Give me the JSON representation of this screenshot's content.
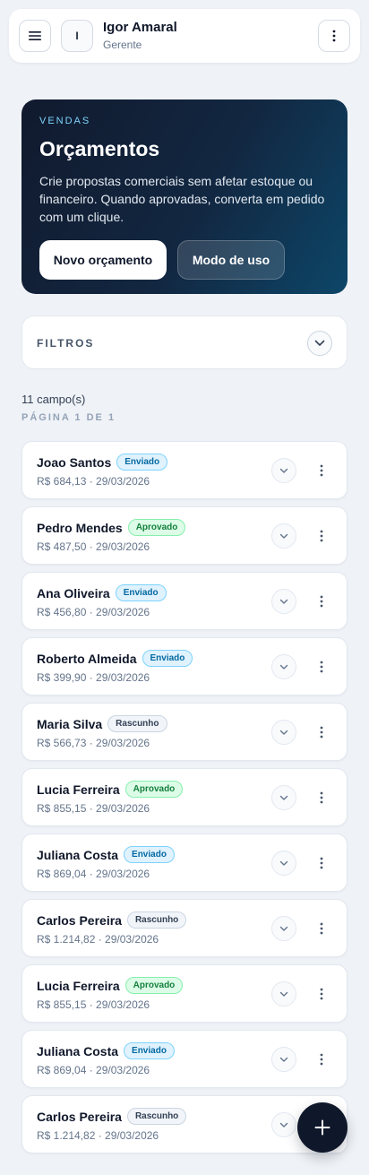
{
  "header": {
    "avatar_initial": "I",
    "user_name": "Igor Amaral",
    "user_role": "Gerente"
  },
  "hero": {
    "eyebrow": "VENDAS",
    "title": "Orçamentos",
    "description": "Crie propostas comerciais sem afetar estoque ou financeiro. Quando aprovadas, converta em pedido com um clique.",
    "primary_button": "Novo orçamento",
    "secondary_button": "Modo de uso"
  },
  "filters": {
    "label": "FILTROS"
  },
  "summary": {
    "count": "11 campo(s)",
    "page": "PÁGINA 1 DE 1"
  },
  "items": [
    {
      "name": "Joao Santos",
      "status": "Enviado",
      "status_key": "enviado",
      "sub": "R$ 684,13 · 29/03/2026"
    },
    {
      "name": "Pedro Mendes",
      "status": "Aprovado",
      "status_key": "aprovado",
      "sub": "R$ 487,50 · 29/03/2026"
    },
    {
      "name": "Ana Oliveira",
      "status": "Enviado",
      "status_key": "enviado",
      "sub": "R$ 456,80 · 29/03/2026"
    },
    {
      "name": "Roberto Almeida",
      "status": "Enviado",
      "status_key": "enviado",
      "sub": "R$ 399,90 · 29/03/2026"
    },
    {
      "name": "Maria Silva",
      "status": "Rascunho",
      "status_key": "rascunho",
      "sub": "R$ 566,73 · 29/03/2026"
    },
    {
      "name": "Lucia Ferreira",
      "status": "Aprovado",
      "status_key": "aprovado",
      "sub": "R$ 855,15 · 29/03/2026"
    },
    {
      "name": "Juliana Costa",
      "status": "Enviado",
      "status_key": "enviado",
      "sub": "R$ 869,04 · 29/03/2026"
    },
    {
      "name": "Carlos Pereira",
      "status": "Rascunho",
      "status_key": "rascunho",
      "sub": "R$ 1.214,82 · 29/03/2026"
    },
    {
      "name": "Lucia Ferreira",
      "status": "Aprovado",
      "status_key": "aprovado",
      "sub": "R$ 855,15 · 29/03/2026"
    },
    {
      "name": "Juliana Costa",
      "status": "Enviado",
      "status_key": "enviado",
      "sub": "R$ 869,04 · 29/03/2026"
    },
    {
      "name": "Carlos Pereira",
      "status": "Rascunho",
      "status_key": "rascunho",
      "sub": "R$ 1.214,82 · 29/03/2026"
    }
  ],
  "icons": {
    "menu": "menu-icon",
    "more": "more-vertical-icon",
    "chevron": "chevron-down-icon",
    "add": "plus-icon"
  },
  "colors": {
    "accent": "#0f172a",
    "hero_eyebrow": "#7dd3fc",
    "enviado": "#0369a1",
    "aprovado": "#15803d",
    "rascunho": "#334155"
  }
}
